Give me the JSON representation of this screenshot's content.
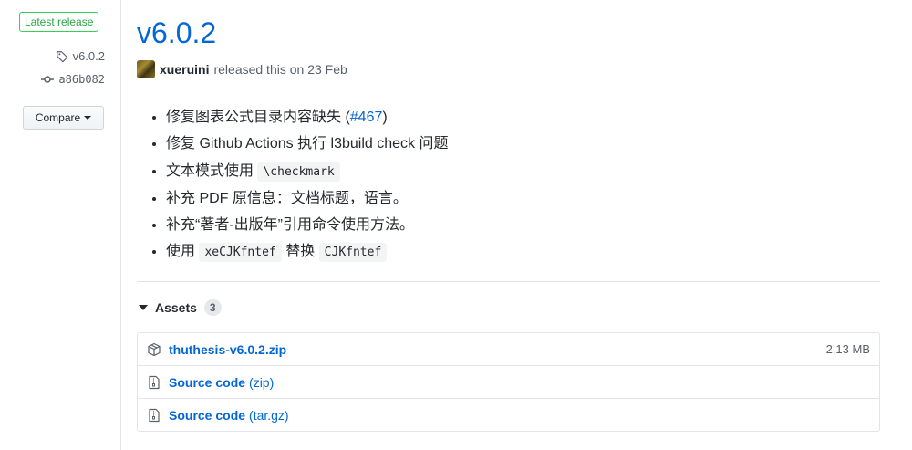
{
  "sidebar": {
    "badge": "Latest release",
    "tag": "v6.0.2",
    "commit": "a86b082",
    "compare_label": "Compare"
  },
  "release": {
    "title": "v6.0.2",
    "author": "xueruini",
    "meta_text": "released this on 23 Feb",
    "notes": {
      "n1_text": "修复图表公式目录内容缺失 (",
      "n1_link": "#467",
      "n1_close": ")",
      "n2": "修复 Github Actions 执行 l3build check 问题",
      "n3_text": "文本模式使用",
      "n3_code": "\\checkmark",
      "n4": "补充 PDF 原信息：文档标题，语言。",
      "n5": "补充“著者-出版年”引用命令使用方法。",
      "n6_pre": "使用",
      "n6_code1": "xeCJKfntef",
      "n6_mid": "替换",
      "n6_code2": "CJKfntef"
    }
  },
  "assets": {
    "heading": "Assets",
    "count": "3",
    "items": [
      {
        "name": "thuthesis-v6.0.2.zip",
        "ext": "",
        "size": "2.13 MB",
        "icon": "package-icon"
      },
      {
        "name": "Source code",
        "ext": "(zip)",
        "size": "",
        "icon": "file-zip-icon"
      },
      {
        "name": "Source code",
        "ext": "(tar.gz)",
        "size": "",
        "icon": "file-zip-icon"
      }
    ]
  },
  "colors": {
    "link": "#0366d6",
    "badge_green": "#28a745",
    "text": "#24292e",
    "muted": "#586069"
  }
}
